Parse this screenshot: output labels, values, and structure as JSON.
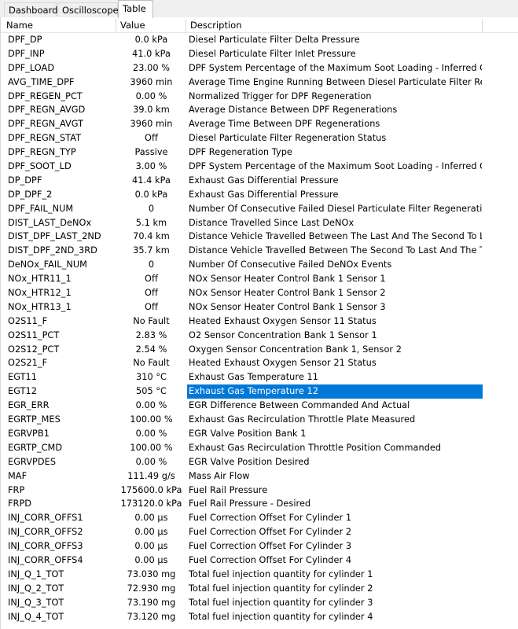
{
  "tabs": [
    {
      "label": "Dashboard"
    },
    {
      "label": "Oscilloscope"
    },
    {
      "label": "Table"
    }
  ],
  "active_tab": "Table",
  "columns": {
    "name": "Name",
    "value": "Value",
    "description": "Description"
  },
  "selected_row_index": 25,
  "colors": {
    "selection": "#0078d7",
    "selection_text": "#ffffff"
  },
  "rows": [
    {
      "name": "DPF_DP",
      "value": "0.0 kPa",
      "description": "Diesel Particulate Filter Delta Pressure"
    },
    {
      "name": "DPF_INP",
      "value": "41.0 kPa",
      "description": "Diesel Particulate Filter Inlet Pressure"
    },
    {
      "name": "DPF_LOAD",
      "value": "23.00 %",
      "description": "DPF System Percentage of the Maximum Soot Loading - Inferred Closed L"
    },
    {
      "name": "AVG_TIME_DPF",
      "value": "3960 min",
      "description": "Average Time Engine Running Between Diesel Particulate Filter Regenera"
    },
    {
      "name": "DPF_REGEN_PCT",
      "value": "0.00 %",
      "description": "Normalized Trigger for DPF Regeneration"
    },
    {
      "name": "DPF_REGN_AVGD",
      "value": "39.0 km",
      "description": "Average Distance Between DPF Regenerations"
    },
    {
      "name": "DPF_REGN_AVGT",
      "value": "3960 min",
      "description": "Average Time Between DPF Regenerations"
    },
    {
      "name": "DPF_REGN_STAT",
      "value": "Off",
      "description": "Diesel Particulate Filter Regeneration Status"
    },
    {
      "name": "DPF_REGN_TYP",
      "value": "Passive",
      "description": "DPF Regeneration Type"
    },
    {
      "name": "DPF_SOOT_LD",
      "value": "3.00 %",
      "description": "DPF System Percentage of the Maximum Soot Loading - Inferred Open Lo"
    },
    {
      "name": "DP_DPF",
      "value": "41.4 kPa",
      "description": "Exhaust Gas Differential Pressure"
    },
    {
      "name": "DP_DPF_2",
      "value": "0.0 kPa",
      "description": "Exhaust Gas Differential Pressure"
    },
    {
      "name": "DPF_FAIL_NUM",
      "value": "0",
      "description": "Number Of Consecutive Failed Diesel Particulate Filter Regeneration Even"
    },
    {
      "name": "DIST_LAST_DeNOx",
      "value": "5.1 km",
      "description": "Distance Travelled Since Last DeNOx"
    },
    {
      "name": "DIST_DPF_LAST_2ND",
      "value": "70.4 km",
      "description": "Distance Vehicle Travelled Between The Last And The Second To Last DF"
    },
    {
      "name": "DIST_DPF_2ND_3RD",
      "value": "35.7 km",
      "description": "Distance Vehicle Travelled Between The Second To Last And The Third T"
    },
    {
      "name": "DeNOx_FAIL_NUM",
      "value": "0",
      "description": "Number Of Consecutive Failed DeNOx Events"
    },
    {
      "name": "NOx_HTR11_1",
      "value": "Off",
      "description": "NOx Sensor Heater Control Bank 1 Sensor 1"
    },
    {
      "name": "NOx_HTR12_1",
      "value": "Off",
      "description": "NOx Sensor Heater Control Bank 1 Sensor 2"
    },
    {
      "name": "NOx_HTR13_1",
      "value": "Off",
      "description": "NOx Sensor Heater Control Bank 1 Sensor 3"
    },
    {
      "name": "O2S11_F",
      "value": "No Fault",
      "description": "Heated Exhaust Oxygen Sensor 11 Status"
    },
    {
      "name": "O2S11_PCT",
      "value": "2.83 %",
      "description": "O2 Sensor Concentration Bank 1 Sensor 1"
    },
    {
      "name": "O2S12_PCT",
      "value": "2.54 %",
      "description": "Oxygen Sensor Concentration Bank 1, Sensor 2"
    },
    {
      "name": "O2S21_F",
      "value": "No Fault",
      "description": "Heated Exhaust Oxygen Sensor 21 Status"
    },
    {
      "name": "EGT11",
      "value": "310 °C",
      "description": "Exhaust Gas Temperature 11"
    },
    {
      "name": "EGT12",
      "value": "505 °C",
      "description": "Exhaust Gas Temperature 12"
    },
    {
      "name": "EGR_ERR",
      "value": "0.00 %",
      "description": "EGR Difference Between Commanded And Actual"
    },
    {
      "name": "EGRTP_MES",
      "value": "100.00 %",
      "description": "Exhaust Gas Recirculation Throttle Plate Measured"
    },
    {
      "name": "EGRVPB1",
      "value": "0.00 %",
      "description": "EGR Valve Position Bank 1"
    },
    {
      "name": "EGRTP_CMD",
      "value": "100.00 %",
      "description": "Exhaust Gas Recirculation Throttle Position Commanded"
    },
    {
      "name": "EGRVPDES",
      "value": "0.00 %",
      "description": "EGR Valve Position Desired"
    },
    {
      "name": "MAF",
      "value": "111.49 g/s",
      "description": "Mass Air Flow"
    },
    {
      "name": "FRP",
      "value": "175600.0 kPa",
      "description": "Fuel Rail Pressure"
    },
    {
      "name": "FRPD",
      "value": "173120.0 kPa",
      "description": "Fuel Rail Pressure - Desired"
    },
    {
      "name": "INJ_CORR_OFFS1",
      "value": "0.00 µs",
      "description": "Fuel Correction Offset For Cylinder 1"
    },
    {
      "name": "INJ_CORR_OFFS2",
      "value": "0.00 µs",
      "description": "Fuel Correction Offset For Cylinder 2"
    },
    {
      "name": "INJ_CORR_OFFS3",
      "value": "0.00 µs",
      "description": "Fuel Correction Offset For Cylinder 3"
    },
    {
      "name": "INJ_CORR_OFFS4",
      "value": "0.00 µs",
      "description": "Fuel Correction Offset For Cylinder 4"
    },
    {
      "name": "INJ_Q_1_TOT",
      "value": "73.030 mg",
      "description": "Total fuel injection quantity for cylinder 1"
    },
    {
      "name": "INJ_Q_2_TOT",
      "value": "72.930 mg",
      "description": "Total fuel injection quantity for cylinder 2"
    },
    {
      "name": "INJ_Q_3_TOT",
      "value": "73.190 mg",
      "description": "Total fuel injection quantity for cylinder 3"
    },
    {
      "name": "INJ_Q_4_TOT",
      "value": "73.120 mg",
      "description": "Total fuel injection quantity for cylinder 4"
    }
  ]
}
